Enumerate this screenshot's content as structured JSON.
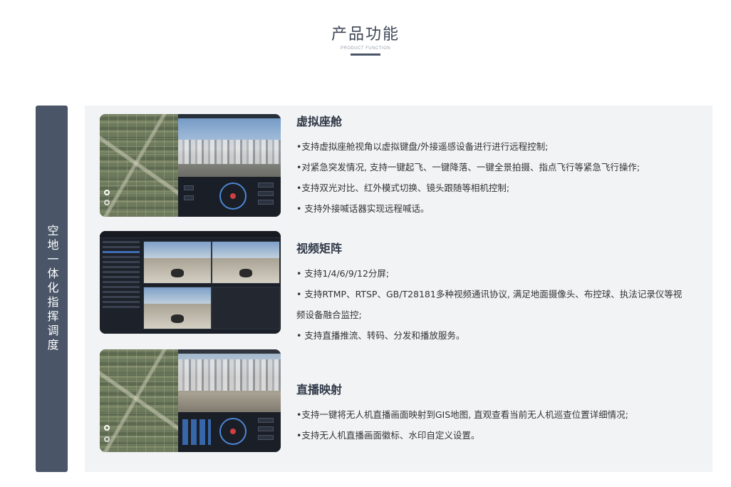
{
  "header": {
    "title": "产品功能",
    "subtitle": "PRODUCT FUNCTION"
  },
  "side_tab": {
    "label": "空地一体化指挥调度"
  },
  "features": [
    {
      "title": "虚拟座舱",
      "bullets": [
        "•支持虚拟座舱视角以虚拟键盘/外接遥感设备进行进行远程控制;",
        "•对紧急突发情况, 支持一键起飞、一键降落、一键全景拍摄、指点飞行等紧急飞行操作;",
        "•支持双光对比、红外模式切换、镜头跟随等相机控制;",
        "• 支持外接喊话器实现远程喊话。"
      ]
    },
    {
      "title": "视频矩阵",
      "bullets": [
        "• 支持1/4/6/9/12分屏;",
        "• 支持RTMP、RTSP、GB/T28181多种视频通讯协议, 满足地面摄像头、布控球、执法记录仪等视频设备融合监控;",
        "• 支持直播推流、转码、分发和播放服务。"
      ]
    },
    {
      "title": "直播映射",
      "bullets": [
        "•支持一键将无人机直播画面映射到GIS地图, 直观查看当前无人机巡查位置详细情况;",
        "•支持无人机直播画面徽标、水印自定义设置。"
      ]
    }
  ],
  "colors": {
    "accent": "#4a5668",
    "panel_bg": "#f2f3f5",
    "title_text": "#3e4757"
  }
}
